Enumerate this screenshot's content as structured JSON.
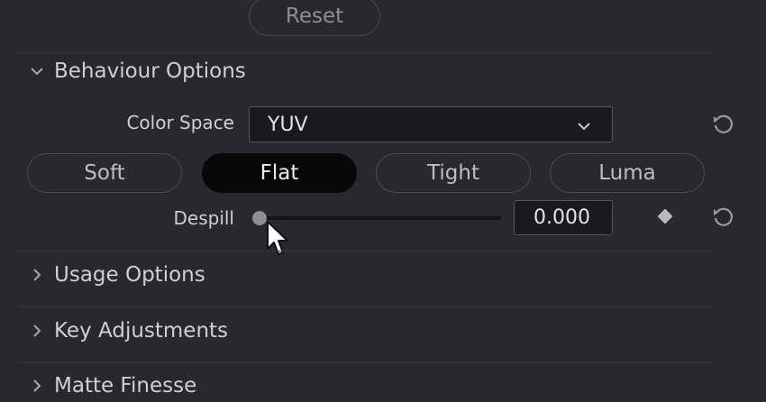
{
  "reset_button": {
    "label": "Reset"
  },
  "behaviour": {
    "title": "Behaviour Options",
    "color_space": {
      "label": "Color Space",
      "value": "YUV"
    },
    "modes": [
      {
        "label": "Soft",
        "active": false
      },
      {
        "label": "Flat",
        "active": true
      },
      {
        "label": "Tight",
        "active": false
      },
      {
        "label": "Luma",
        "active": false
      }
    ],
    "despill": {
      "label": "Despill",
      "value": "0.000",
      "slider_fraction": 0.0
    }
  },
  "sections": [
    {
      "title": "Usage Options",
      "expanded": false
    },
    {
      "title": "Key Adjustments",
      "expanded": false
    },
    {
      "title": "Matte Finesse",
      "expanded": false
    }
  ],
  "icons": {
    "expanded_chevron": "chevron-down-icon",
    "collapsed_chevron": "chevron-right-icon",
    "reset": "reset-arrow-icon",
    "keyframe": "keyframe-diamond-icon",
    "cursor": "mouse-pointer-icon"
  },
  "colors": {
    "background": "#28282e",
    "field_bg": "#1a1a1d",
    "active_button": "#080808",
    "text": "#cfcfd4"
  }
}
